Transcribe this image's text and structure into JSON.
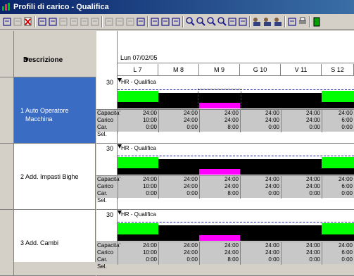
{
  "window": {
    "title": "Profili di carico - Qualifica"
  },
  "left": {
    "header": "Descrizione",
    "rows": [
      {
        "num": "1",
        "label": "Auto Operatore Macchina"
      },
      {
        "num": "2",
        "label": "Add. Impasti Bighe"
      },
      {
        "num": "3",
        "label": "Add. Cambi"
      }
    ]
  },
  "grid": {
    "date": "Lun 07/02/05",
    "days": [
      "L 7",
      "M 8",
      "M 9",
      "G 10",
      "V 11",
      "S 12"
    ],
    "row_scale": "30",
    "row_title": "HR - Qualifica",
    "stat_labels": [
      "Capacita'",
      "Carico",
      "Car. Sel."
    ],
    "rows": [
      {
        "capacita": [
          "24:00",
          "24:00",
          "24:00",
          "24:00",
          "24:00",
          "24:00"
        ],
        "carico": [
          "10:00",
          "24:00",
          "24:00",
          "24:00",
          "24:00",
          "6:00"
        ],
        "car_sel": [
          "0:00",
          "0:00",
          "8:00",
          "0:00",
          "0:00",
          "0:00"
        ]
      },
      {
        "capacita": [
          "24:00",
          "24:00",
          "24:00",
          "24:00",
          "24:00",
          "24:00"
        ],
        "carico": [
          "10:00",
          "24:00",
          "24:00",
          "24:00",
          "24:00",
          "6:00"
        ],
        "car_sel": [
          "0:00",
          "0:00",
          "8:00",
          "0:00",
          "0:00",
          "0:00"
        ]
      },
      {
        "capacita": [
          "24:00",
          "24:00",
          "24:00",
          "24:00",
          "24:00",
          "24:00"
        ],
        "carico": [
          "10:00",
          "24:00",
          "24:00",
          "24:00",
          "24:00",
          "6:00"
        ],
        "car_sel": [
          "0:00",
          "0:00",
          "8:00",
          "0:00",
          "0:00",
          "0:00"
        ]
      }
    ]
  },
  "colors": {
    "capacity": "#000000",
    "load": "#00ff00",
    "selected_load": "#ff00ff",
    "selection": "#3b6cc4"
  }
}
